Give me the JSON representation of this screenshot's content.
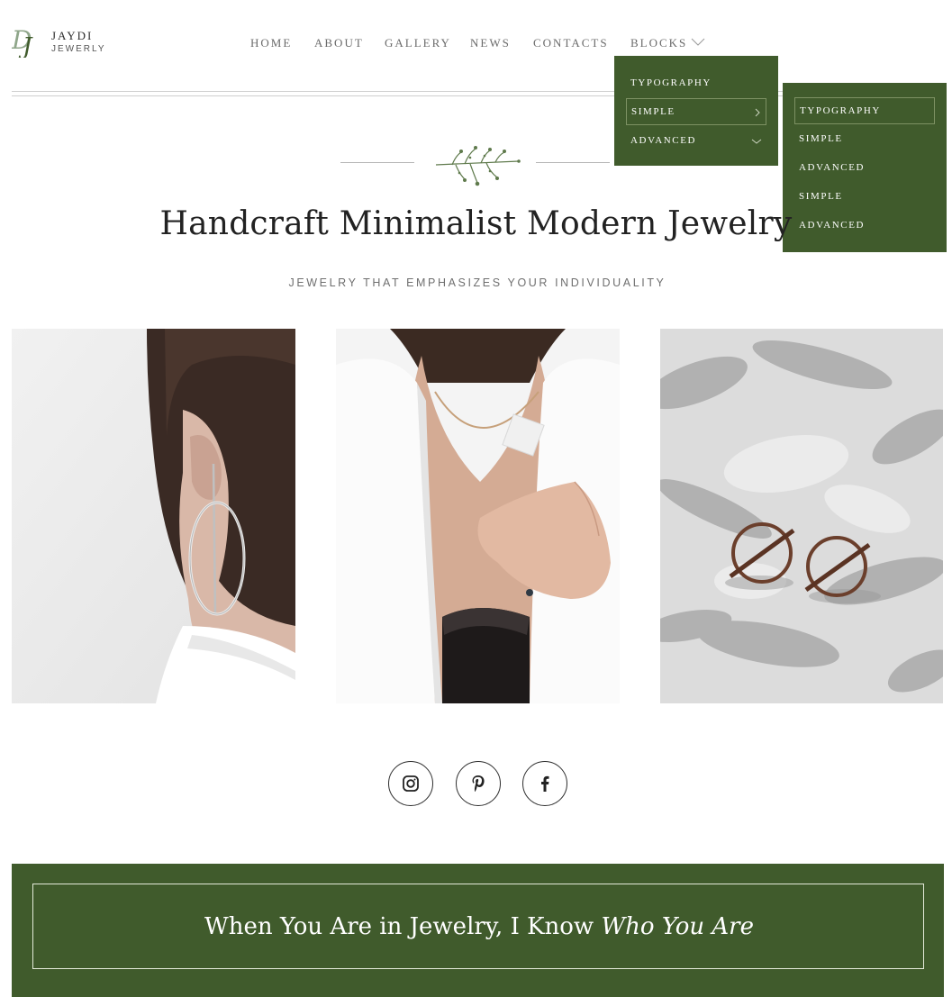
{
  "brand": {
    "name": "JAYDI",
    "tagline": "JEWERLY",
    "monogram": "DJ",
    "accent": "#405b2c"
  },
  "nav": {
    "items": [
      "HOME",
      "ABOUT",
      "GALLERY",
      "NEWS",
      "CONTACTS",
      "BLOCKS"
    ]
  },
  "dropdown_blocks": {
    "items": [
      {
        "label": "TYPOGRAPHY"
      },
      {
        "label": "SIMPLE",
        "active": true,
        "submenu_icon": "chevron-right-icon"
      },
      {
        "label": "ADVANCED",
        "submenu_icon": "chevron-down-icon"
      }
    ]
  },
  "dropdown_simple": {
    "items": [
      {
        "label": "TYPOGRAPHY",
        "active": true
      },
      {
        "label": "SIMPLE"
      },
      {
        "label": "ADVANCED"
      },
      {
        "label": "SIMPLE"
      },
      {
        "label": "ADVANCED"
      }
    ]
  },
  "hero": {
    "title": "Handcraft Minimalist Modern  Jewelry",
    "subtitle": "JEWELRY THAT EMPHASIZES YOUR INDIVIDUALITY"
  },
  "gallery": [
    {
      "subject": "hoop-earring-photo"
    },
    {
      "subject": "marble-pendant-necklace-photo"
    },
    {
      "subject": "rose-gold-circle-earrings-photo"
    }
  ],
  "social": [
    {
      "name": "instagram-icon"
    },
    {
      "name": "pinterest-icon"
    },
    {
      "name": "facebook-icon"
    }
  ],
  "banner": {
    "text_regular": "When You Are in Jewelry, I Know ",
    "text_italic": "Who You Are"
  }
}
